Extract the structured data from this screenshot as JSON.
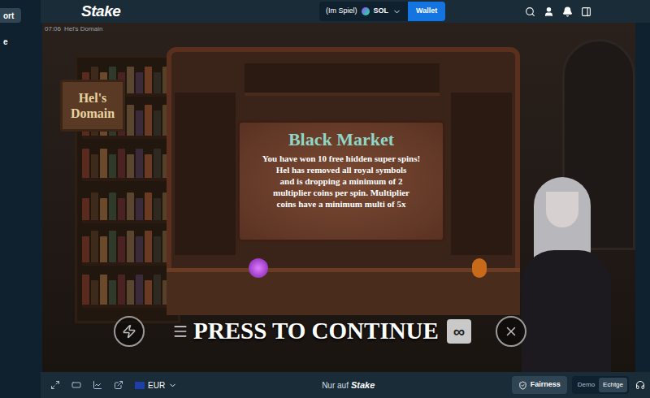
{
  "sidebar": {
    "items": [
      {
        "label": "ort",
        "selected": true
      },
      {
        "label": "e",
        "selected": false
      }
    ]
  },
  "header": {
    "logo": "Stake",
    "balance": {
      "label": "(Im Spiel)",
      "currency": "SOL"
    },
    "wallet_button": "Wallet"
  },
  "game": {
    "time": "07:06",
    "title": "Hel's Domain",
    "sign": [
      "Hel's",
      "Domain"
    ],
    "dialog": {
      "title": "Black Market",
      "lines": [
        "You have won 10 free hidden super spins!",
        "Hel has removed all royal symbols",
        "and is dropping a minimum of 2",
        "multiplier coins per spin. Multiplier",
        "coins have a minimum multi of 5x"
      ]
    },
    "continue": "PRESS TO CONTINUE",
    "autoplay_symbol": "∞"
  },
  "footer": {
    "currency": "EUR",
    "center": "Nur auf",
    "center_logo": "Stake",
    "fairness": "Fairness",
    "modes": [
      {
        "label": "Demo",
        "selected": false
      },
      {
        "label": "Echtge",
        "selected": true
      }
    ]
  }
}
